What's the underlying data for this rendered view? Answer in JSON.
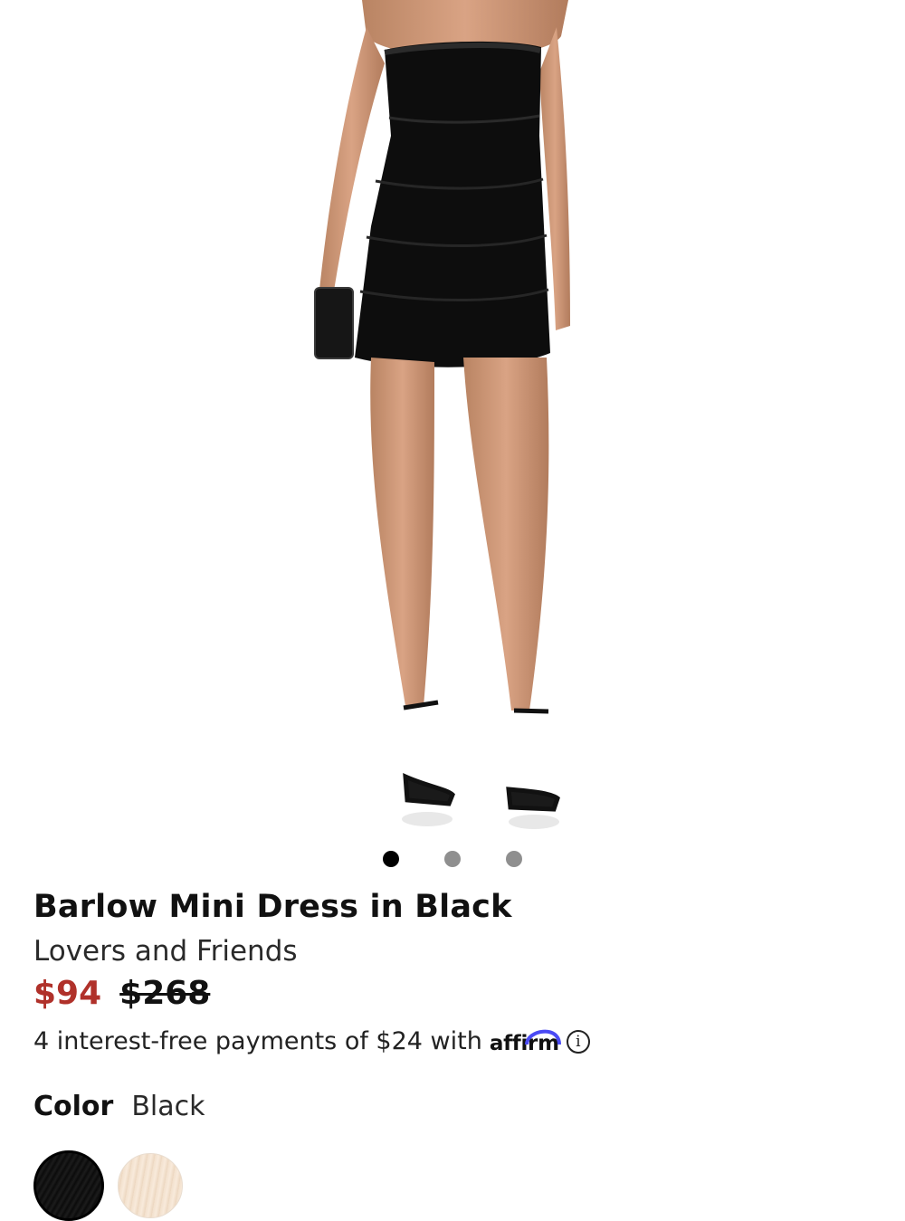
{
  "product": {
    "image_alt": "Barlow Mini Dress in Black worn by model",
    "title": "Barlow Mini Dress in Black",
    "brand": "Lovers and Friends",
    "sale_price": "$94",
    "original_price": "$268",
    "sale_price_color": "#b0312a"
  },
  "carousel": {
    "slide_count": 3,
    "active_index": 0
  },
  "financing": {
    "text": "4 interest-free payments of $24 with",
    "provider": "affirm",
    "info_icon": "info-icon",
    "info_glyph": "i"
  },
  "color": {
    "label": "Color",
    "selected": "Black",
    "swatches": [
      {
        "name": "Black",
        "selected": true,
        "color": "#111111"
      },
      {
        "name": "Blush",
        "selected": false,
        "color": "#f2e0cc"
      }
    ]
  }
}
